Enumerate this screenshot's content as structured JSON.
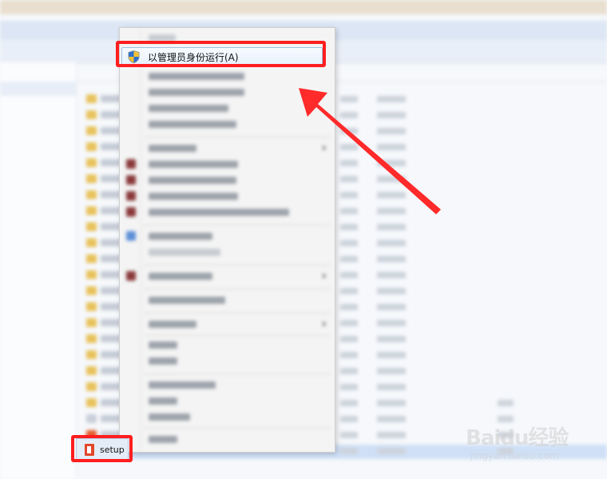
{
  "context_menu": {
    "run_as_admin_label": "以管理员身份运行(A)"
  },
  "file": {
    "name": "setup"
  },
  "watermark": {
    "brand": "Baidu经验",
    "url": "jingyan.baidu.com"
  },
  "colors": {
    "highlight_box": "#ff1e1e",
    "arrow": "#ff2a2a",
    "menu_hover": "#e6f0fb"
  },
  "icons": {
    "run_as_admin": "uac-shield-icon",
    "setup_file": "office-setup-icon"
  }
}
